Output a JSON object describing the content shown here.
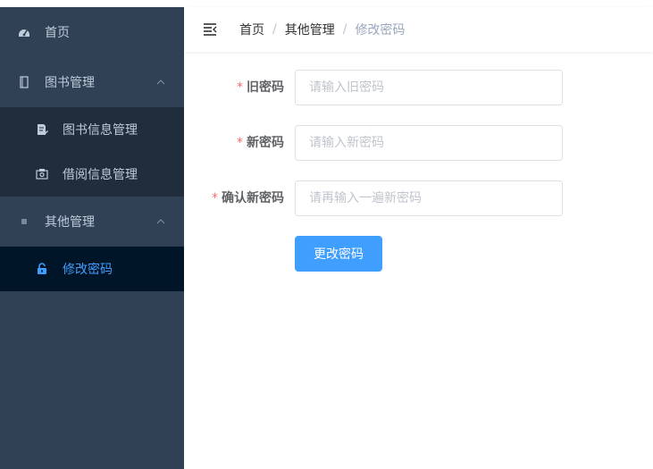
{
  "sidebar": {
    "home": {
      "label": "首页",
      "icon": "dashboard-icon"
    },
    "books_menu": {
      "label": "图书管理",
      "icon": "book-icon",
      "items": [
        {
          "label": "图书信息管理",
          "icon": "document-edit-icon"
        },
        {
          "label": "借阅信息管理",
          "icon": "borrow-icon"
        }
      ]
    },
    "other_menu": {
      "label": "其他管理",
      "icon": "list-icon",
      "items": [
        {
          "label": "修改密码",
          "icon": "lock-icon",
          "active": true
        }
      ]
    }
  },
  "navbar": {
    "breadcrumb": [
      "首页",
      "其他管理",
      "修改密码"
    ],
    "separator": "/"
  },
  "form": {
    "old_password": {
      "label": "旧密码",
      "placeholder": "请输入旧密码",
      "value": ""
    },
    "new_password": {
      "label": "新密码",
      "placeholder": "请输入新密码",
      "value": ""
    },
    "confirm_password": {
      "label": "确认新密码",
      "placeholder": "请再输入一遍新密码",
      "value": ""
    },
    "required_mark": "*",
    "submit_label": "更改密码"
  },
  "colors": {
    "sidebar_bg": "#304156",
    "submenu_bg": "#1f2d3d",
    "active_bg": "#001528",
    "accent": "#409eff",
    "required": "#f56c6c"
  }
}
